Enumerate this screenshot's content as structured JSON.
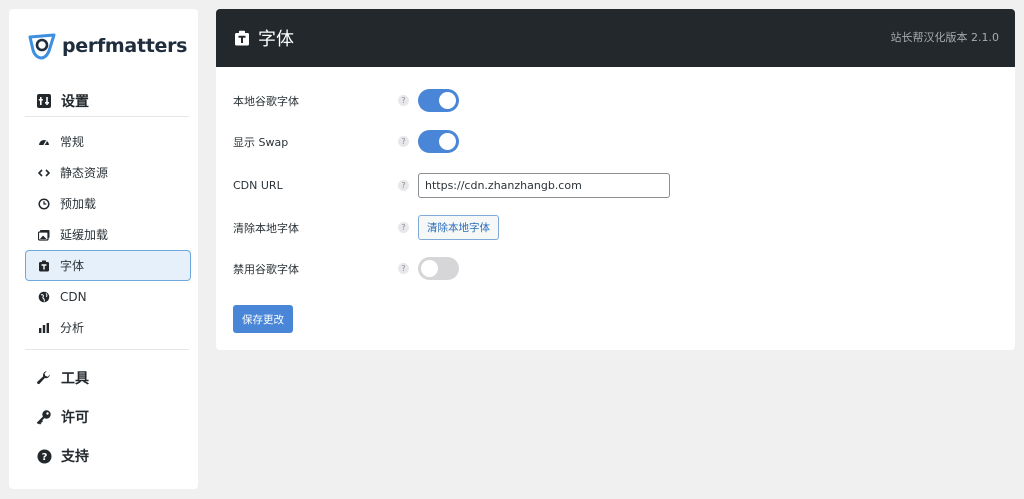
{
  "brand": {
    "name": "perfmatters"
  },
  "sidebar": {
    "settings_label": "设置",
    "items": [
      {
        "label": "常规",
        "icon": "dashboard-icon"
      },
      {
        "label": "静态资源",
        "icon": "code-icon"
      },
      {
        "label": "预加载",
        "icon": "clock-icon"
      },
      {
        "label": "延缓加载",
        "icon": "images-icon"
      },
      {
        "label": "字体",
        "icon": "font-icon",
        "active": true
      },
      {
        "label": "CDN",
        "icon": "globe-icon"
      },
      {
        "label": "分析",
        "icon": "bar-chart-icon"
      }
    ],
    "tools_label": "工具",
    "license_label": "许可",
    "support_label": "支持"
  },
  "header": {
    "title": "字体",
    "version": "站长帮汉化版本 2.1.0"
  },
  "form": {
    "local_google_fonts": {
      "label": "本地谷歌字体",
      "enabled": true
    },
    "display_swap": {
      "label": "显示 Swap",
      "enabled": true
    },
    "cdn_url": {
      "label": "CDN URL",
      "value": "https://cdn.zhanzhangb.com"
    },
    "clear_local_fonts": {
      "label": "清除本地字体",
      "button": "清除本地字体"
    },
    "disable_google_fonts": {
      "label": "禁用谷歌字体",
      "enabled": false
    },
    "help": "?",
    "save_button": "保存更改"
  },
  "colors": {
    "accent": "#4a86d8",
    "header_bg": "#23282d",
    "active_bg": "#e5f0fb"
  }
}
